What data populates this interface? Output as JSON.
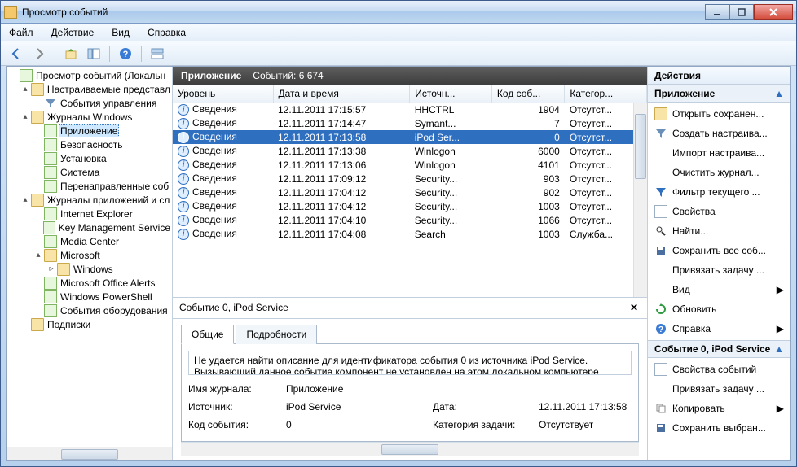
{
  "window": {
    "title": "Просмотр событий"
  },
  "menu": {
    "file": "Файл",
    "action": "Действие",
    "view": "Вид",
    "help": "Справка"
  },
  "tree": {
    "root": "Просмотр событий (Локальн",
    "custom": "Настраиваемые представл",
    "adminEvents": "События управления",
    "winLogs": "Журналы Windows",
    "app": "Приложение",
    "security": "Безопасность",
    "setup": "Установка",
    "system": "Система",
    "forwarded": "Перенаправленные соб",
    "appServ": "Журналы приложений и сл",
    "ie": "Internet Explorer",
    "kms": "Key Management Service",
    "mc": "Media Center",
    "ms": "Microsoft",
    "win": "Windows",
    "moa": "Microsoft Office Alerts",
    "wps": "Windows PowerShell",
    "hw": "События оборудования",
    "subs": "Подписки"
  },
  "mid": {
    "title": "Приложение",
    "count": "Событий: 6 674"
  },
  "columns": {
    "level": "Уровень",
    "datetime": "Дата и время",
    "source": "Источн...",
    "id": "Код соб...",
    "cat": "Категор..."
  },
  "rows": [
    {
      "level": "Сведения",
      "dt": "12.11.2011 17:15:57",
      "src": "HHCTRL",
      "id": "1904",
      "cat": "Отсутст..."
    },
    {
      "level": "Сведения",
      "dt": "12.11.2011 17:14:47",
      "src": "Symant...",
      "id": "7",
      "cat": "Отсутст..."
    },
    {
      "level": "Сведения",
      "dt": "12.11.2011 17:13:58",
      "src": "iPod Ser...",
      "id": "0",
      "cat": "Отсутст...",
      "selected": true
    },
    {
      "level": "Сведения",
      "dt": "12.11.2011 17:13:38",
      "src": "Winlogon",
      "id": "6000",
      "cat": "Отсутст..."
    },
    {
      "level": "Сведения",
      "dt": "12.11.2011 17:13:06",
      "src": "Winlogon",
      "id": "4101",
      "cat": "Отсутст..."
    },
    {
      "level": "Сведения",
      "dt": "12.11.2011 17:09:12",
      "src": "Security...",
      "id": "903",
      "cat": "Отсутст..."
    },
    {
      "level": "Сведения",
      "dt": "12.11.2011 17:04:12",
      "src": "Security...",
      "id": "902",
      "cat": "Отсутст..."
    },
    {
      "level": "Сведения",
      "dt": "12.11.2011 17:04:12",
      "src": "Security...",
      "id": "1003",
      "cat": "Отсутст..."
    },
    {
      "level": "Сведения",
      "dt": "12.11.2011 17:04:10",
      "src": "Security...",
      "id": "1066",
      "cat": "Отсутст..."
    },
    {
      "level": "Сведения",
      "dt": "12.11.2011 17:04:08",
      "src": "Search",
      "id": "1003",
      "cat": "Служба..."
    }
  ],
  "detail": {
    "title": "Событие 0, iPod Service",
    "tabGeneral": "Общие",
    "tabDetails": "Подробности",
    "desc1": "Не удается найти описание для идентификатора события 0 из источника iPod Service.",
    "desc2": "Вызывающий данное событие компонент не установлен на этом локальном компьютере",
    "logNameK": "Имя журнала:",
    "logNameV": "Приложение",
    "sourceK": "Источник:",
    "sourceV": "iPod Service",
    "dateK": "Дата:",
    "dateV": "12.11.2011 17:13:58",
    "idK": "Код события:",
    "idV": "0",
    "catK": "Категория задачи:",
    "catV": "Отсутствует"
  },
  "actions": {
    "title": "Действия",
    "sec1": "Приложение",
    "open": "Открыть сохранен...",
    "createView": "Создать настраива...",
    "import": "Импорт настраива...",
    "clear": "Очистить журнал...",
    "filter": "Фильтр текущего ...",
    "props": "Свойства",
    "find": "Найти...",
    "saveAll": "Сохранить все соб...",
    "attachTask": "Привязать задачу ...",
    "view": "Вид",
    "refresh": "Обновить",
    "help": "Справка",
    "sec2": "Событие 0, iPod Service",
    "evtProps": "Свойства событий",
    "evtTask": "Привязать задачу ...",
    "copy": "Копировать",
    "saveSel": "Сохранить выбран..."
  }
}
